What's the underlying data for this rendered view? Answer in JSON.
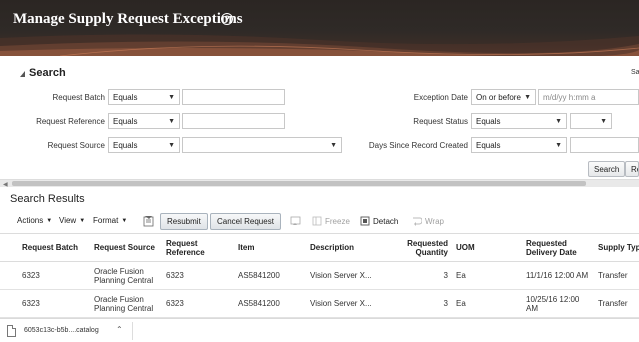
{
  "header": {
    "title": "Manage Supply Request Exceptions",
    "help_glyph": "?"
  },
  "search": {
    "title": "Search",
    "saved_search_label": "Sa",
    "request_batch": {
      "label": "Request Batch",
      "operator": "Equals",
      "value": ""
    },
    "request_reference": {
      "label": "Request Reference",
      "operator": "Equals",
      "value": ""
    },
    "request_source": {
      "label": "Request Source",
      "operator": "Equals",
      "value": ""
    },
    "exception_date": {
      "label": "Exception Date",
      "operator": "On or before",
      "placeholder": "m/d/yy h:mm a"
    },
    "request_status": {
      "label": "Request Status",
      "operator": "Equals",
      "value": ""
    },
    "days_since_record_created": {
      "label": "Days Since Record Created",
      "operator": "Equals",
      "value": ""
    },
    "search_button": "Search",
    "reset_button": "Re"
  },
  "results": {
    "title": "Search Results",
    "toolbar": {
      "actions": "Actions",
      "view": "View",
      "format": "Format",
      "resubmit": "Resubmit",
      "cancel_request": "Cancel Request",
      "freeze": "Freeze",
      "detach": "Detach",
      "wrap": "Wrap"
    },
    "columns": [
      "Request Batch",
      "Request Source",
      "Request Reference",
      "Item",
      "Description",
      "Requested Quantity",
      "UOM",
      "Requested Delivery Date",
      "Supply Typ"
    ],
    "rows": [
      {
        "batch": "6323",
        "source": "Oracle Fusion Planning Central",
        "reference": "6323",
        "item": "AS5841200",
        "description": "Vision Server X...",
        "quantity": "3",
        "uom": "Ea",
        "delivery_date": "11/1/16 12:00 AM",
        "supply_type": "Transfer"
      },
      {
        "batch": "6323",
        "source": "Oracle Fusion Planning Central",
        "reference": "6323",
        "item": "AS5841200",
        "description": "Vision Server X...",
        "quantity": "3",
        "uom": "Ea",
        "delivery_date": "10/25/16 12:00 AM",
        "supply_type": "Transfer"
      }
    ]
  },
  "download": {
    "filename": "6053c13c-b5b....catalog"
  },
  "colors": {
    "header_bg": "#2b2623",
    "accent_orange": "#c0552d"
  },
  "icons": [
    "help-icon",
    "collapse-triangle-icon",
    "query-by-example-icon",
    "freeze-icon",
    "detach-icon",
    "wrap-icon",
    "file-icon",
    "chevron-up-icon"
  ]
}
